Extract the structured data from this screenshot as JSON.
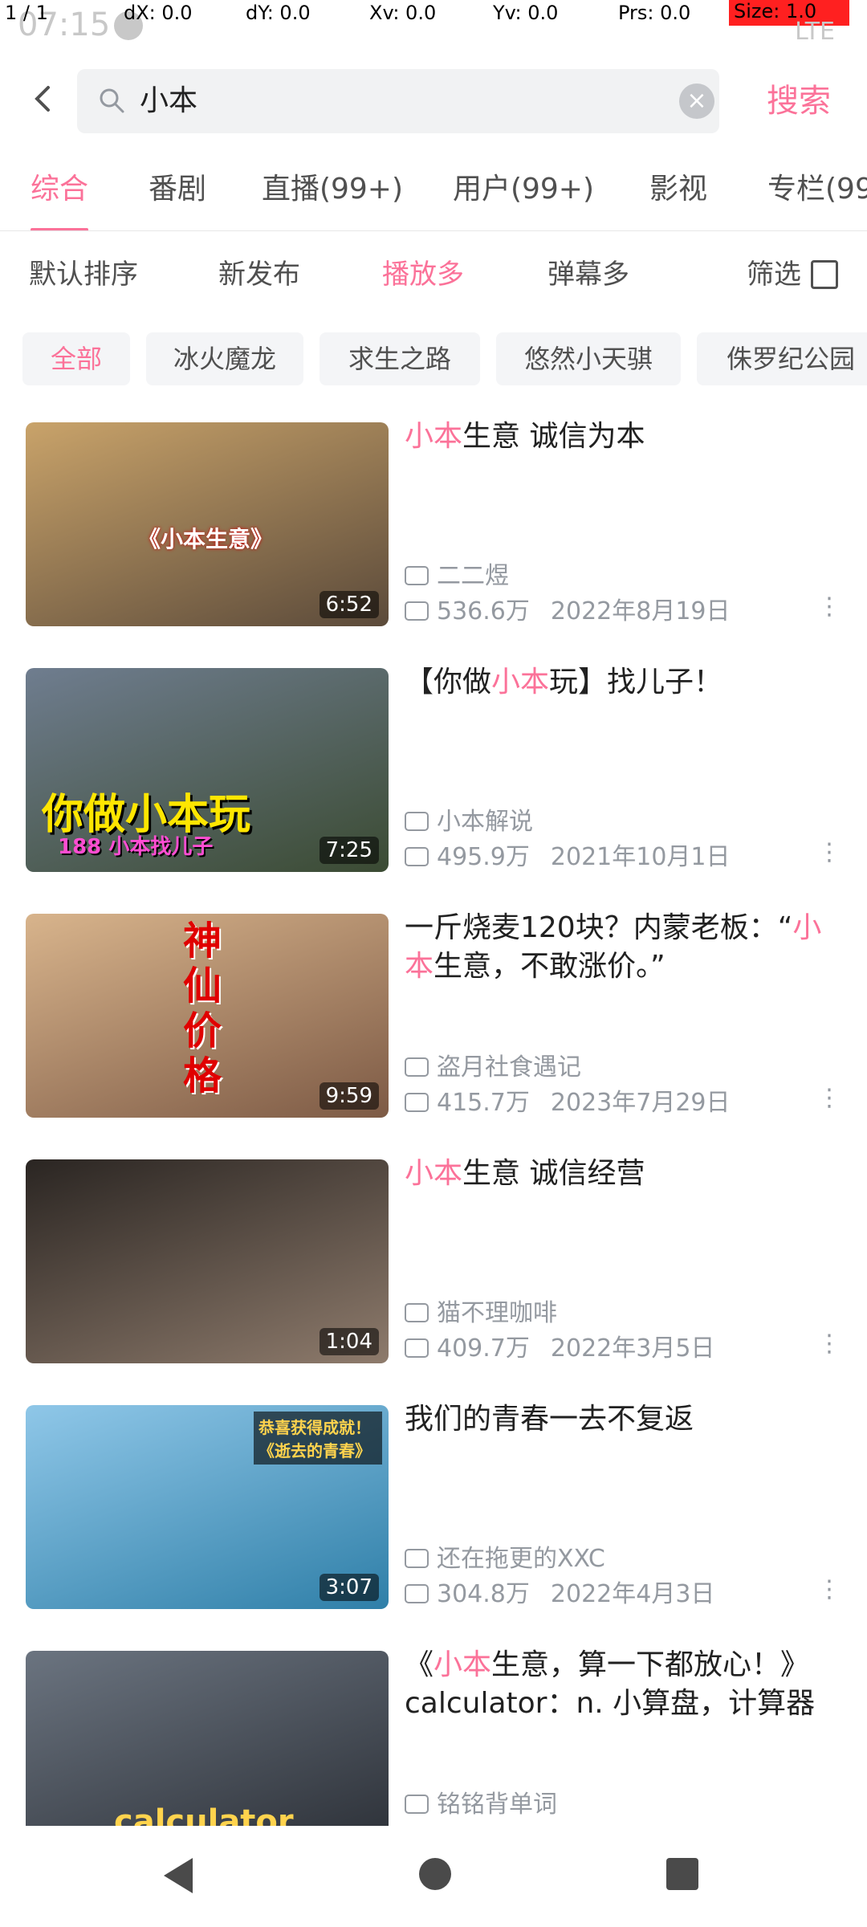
{
  "status_bar": {
    "time": "07:15",
    "debug": {
      "pointer": "1 / 1",
      "dx": "dX: 0.0",
      "dy": "dY: 0.0",
      "xv": "Xv: 0.0",
      "yv": "Yv: 0.0",
      "prs": "Prs: 0.0",
      "size": "Size: 1.0"
    },
    "network": "LTE"
  },
  "search": {
    "back_icon": "back-arrow-icon",
    "query": "小本",
    "search_icon": "magnifier-icon",
    "clear_icon": "clear-icon",
    "button_label": "搜索"
  },
  "tabs": [
    {
      "label": "综合",
      "active": true
    },
    {
      "label": "番剧"
    },
    {
      "label": "直播(99+)"
    },
    {
      "label": "用户(99+)"
    },
    {
      "label": "影视"
    },
    {
      "label": "专栏(99"
    }
  ],
  "sort": {
    "items": [
      {
        "label": "默认排序",
        "active": false
      },
      {
        "label": "新发布",
        "active": false
      },
      {
        "label": "播放多",
        "active": true
      },
      {
        "label": "弹幕多",
        "active": false
      }
    ],
    "filter_label": "筛选",
    "filter_icon": "filter-icon"
  },
  "categories": [
    {
      "label": "全部",
      "active": true
    },
    {
      "label": "冰火魔龙"
    },
    {
      "label": "求生之路"
    },
    {
      "label": "悠然小天骐"
    },
    {
      "label": "侏罗纪公园"
    }
  ],
  "highlight_color": "#fb7299",
  "videos": [
    {
      "title_parts": [
        {
          "t": "小本",
          "hl": true
        },
        {
          "t": "生意 诚信为本",
          "hl": false
        }
      ],
      "up": "二二煜",
      "views": "536.6万",
      "date": "2022年8月19日",
      "duration": "6:52",
      "thumb_caption": "《小本生意》",
      "thumb_colors": [
        "#c9a36a",
        "#5b4a3a"
      ]
    },
    {
      "title_parts": [
        {
          "t": "【你做",
          "hl": false
        },
        {
          "t": "小本",
          "hl": true
        },
        {
          "t": "玩】找儿子！",
          "hl": false
        }
      ],
      "up": "小本解说",
      "views": "495.9万",
      "date": "2021年10月1日",
      "duration": "7:25",
      "thumb_caption": "你做小本玩",
      "thumb_subcaption": "188 小本找儿子",
      "thumb_colors": [
        "#6f7d8f",
        "#3b4b33"
      ]
    },
    {
      "title_parts": [
        {
          "t": "一斤烧麦120块？内蒙老板：“",
          "hl": false
        },
        {
          "t": "小本",
          "hl": true
        },
        {
          "t": "生意，不敢涨价。”",
          "hl": false
        }
      ],
      "up": "盗月社食遇记",
      "views": "415.7万",
      "date": "2023年7月29日",
      "duration": "9:59",
      "thumb_caption": "神仙价格",
      "thumb_colors": [
        "#d8b48c",
        "#7d5a45"
      ]
    },
    {
      "title_parts": [
        {
          "t": "小本",
          "hl": true
        },
        {
          "t": "生意 诚信经营",
          "hl": false
        }
      ],
      "up": "猫不理咖啡",
      "views": "409.7万",
      "date": "2022年3月5日",
      "duration": "1:04",
      "thumb_colors": [
        "#2a2522",
        "#8e7b6c"
      ]
    },
    {
      "title_parts": [
        {
          "t": "我们的青春一去不复返",
          "hl": false
        }
      ],
      "up": "还在拖更的XXC",
      "views": "304.8万",
      "date": "2022年4月3日",
      "duration": "3:07",
      "thumb_caption": "恭喜获得成就！《逝去的青春》",
      "thumb_colors": [
        "#8fc7e8",
        "#2f7fa8"
      ]
    },
    {
      "title_parts": [
        {
          "t": "《",
          "hl": false
        },
        {
          "t": "小本",
          "hl": true
        },
        {
          "t": "生意，算一下都放心！》calculator：n. 小算盘，计算器",
          "hl": false
        }
      ],
      "up": "铭铭背单词",
      "views": "",
      "date": "",
      "duration": "",
      "thumb_caption": "calculator",
      "thumb_colors": [
        "#6b7480",
        "#2b2f36"
      ]
    }
  ],
  "nav_bar": {
    "back_icon": "nav-back-icon",
    "home_icon": "nav-home-icon",
    "recent_icon": "nav-recent-icon"
  }
}
